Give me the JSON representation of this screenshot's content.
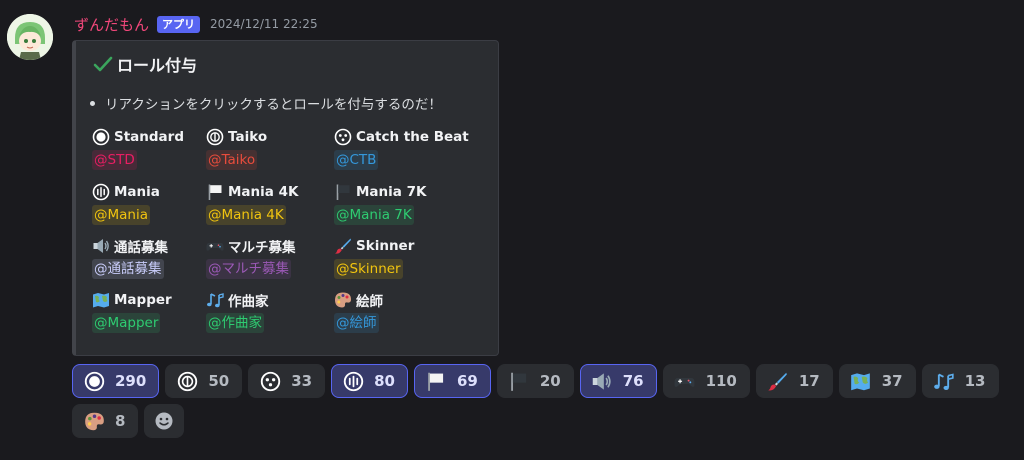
{
  "message": {
    "author": "ずんだもん",
    "badge": "アプリ",
    "timestamp": "2024/12/11 22:25"
  },
  "embed": {
    "title": "ロール付与",
    "description": "リアクションをクリックするとロールを付与するのだ！",
    "fields": [
      {
        "name": "Standard",
        "icon": "standard-mode-icon",
        "mention": "@STD",
        "color": "#e91e63"
      },
      {
        "name": "Taiko",
        "icon": "taiko-mode-icon",
        "mention": "@Taiko",
        "color": "#e74c3c"
      },
      {
        "name": "Catch the Beat",
        "icon": "catch-mode-icon",
        "mention": "@CTB",
        "color": "#3498db"
      },
      {
        "name": "Mania",
        "icon": "mania-mode-icon",
        "mention": "@Mania",
        "color": "#f1c40f"
      },
      {
        "name": "Mania 4K",
        "icon": "white-flag-icon",
        "mention": "@Mania 4K",
        "color": "#f1c40f"
      },
      {
        "name": "Mania 7K",
        "icon": "black-flag-icon",
        "mention": "@Mania 7K",
        "color": "#2ecc71"
      },
      {
        "name": "通話募集",
        "icon": "speaker-icon",
        "mention": "@通話募集",
        "color": "#c9cdfb"
      },
      {
        "name": "マルチ募集",
        "icon": "gamepad-icon",
        "mention": "@マルチ募集",
        "color": "#9b59b6"
      },
      {
        "name": "Skinner",
        "icon": "paintbrush-icon",
        "mention": "@Skinner",
        "color": "#f1c40f"
      },
      {
        "name": "Mapper",
        "icon": "world-map-icon",
        "mention": "@Mapper",
        "color": "#2ecc71"
      },
      {
        "name": "作曲家",
        "icon": "music-notes-icon",
        "mention": "@作曲家",
        "color": "#2ecc71"
      },
      {
        "name": "絵師",
        "icon": "palette-icon",
        "mention": "@絵師",
        "color": "#3498db"
      }
    ]
  },
  "reactions": [
    {
      "icon": "standard-mode-icon",
      "count": "290",
      "active": true
    },
    {
      "icon": "taiko-mode-icon",
      "count": "50",
      "active": false
    },
    {
      "icon": "catch-mode-icon",
      "count": "33",
      "active": false
    },
    {
      "icon": "mania-mode-icon",
      "count": "80",
      "active": true
    },
    {
      "icon": "white-flag-icon",
      "count": "69",
      "active": true
    },
    {
      "icon": "black-flag-icon",
      "count": "20",
      "active": false
    },
    {
      "icon": "speaker-icon",
      "count": "76",
      "active": true
    },
    {
      "icon": "gamepad-icon",
      "count": "110",
      "active": false
    },
    {
      "icon": "paintbrush-icon",
      "count": "17",
      "active": false
    },
    {
      "icon": "world-map-icon",
      "count": "37",
      "active": false
    },
    {
      "icon": "music-notes-icon",
      "count": "13",
      "active": false
    },
    {
      "icon": "palette-icon",
      "count": "8",
      "active": false
    }
  ],
  "colors": {
    "accent": "#5865f2",
    "author": "#f0477a",
    "check": "#3ba55d"
  }
}
